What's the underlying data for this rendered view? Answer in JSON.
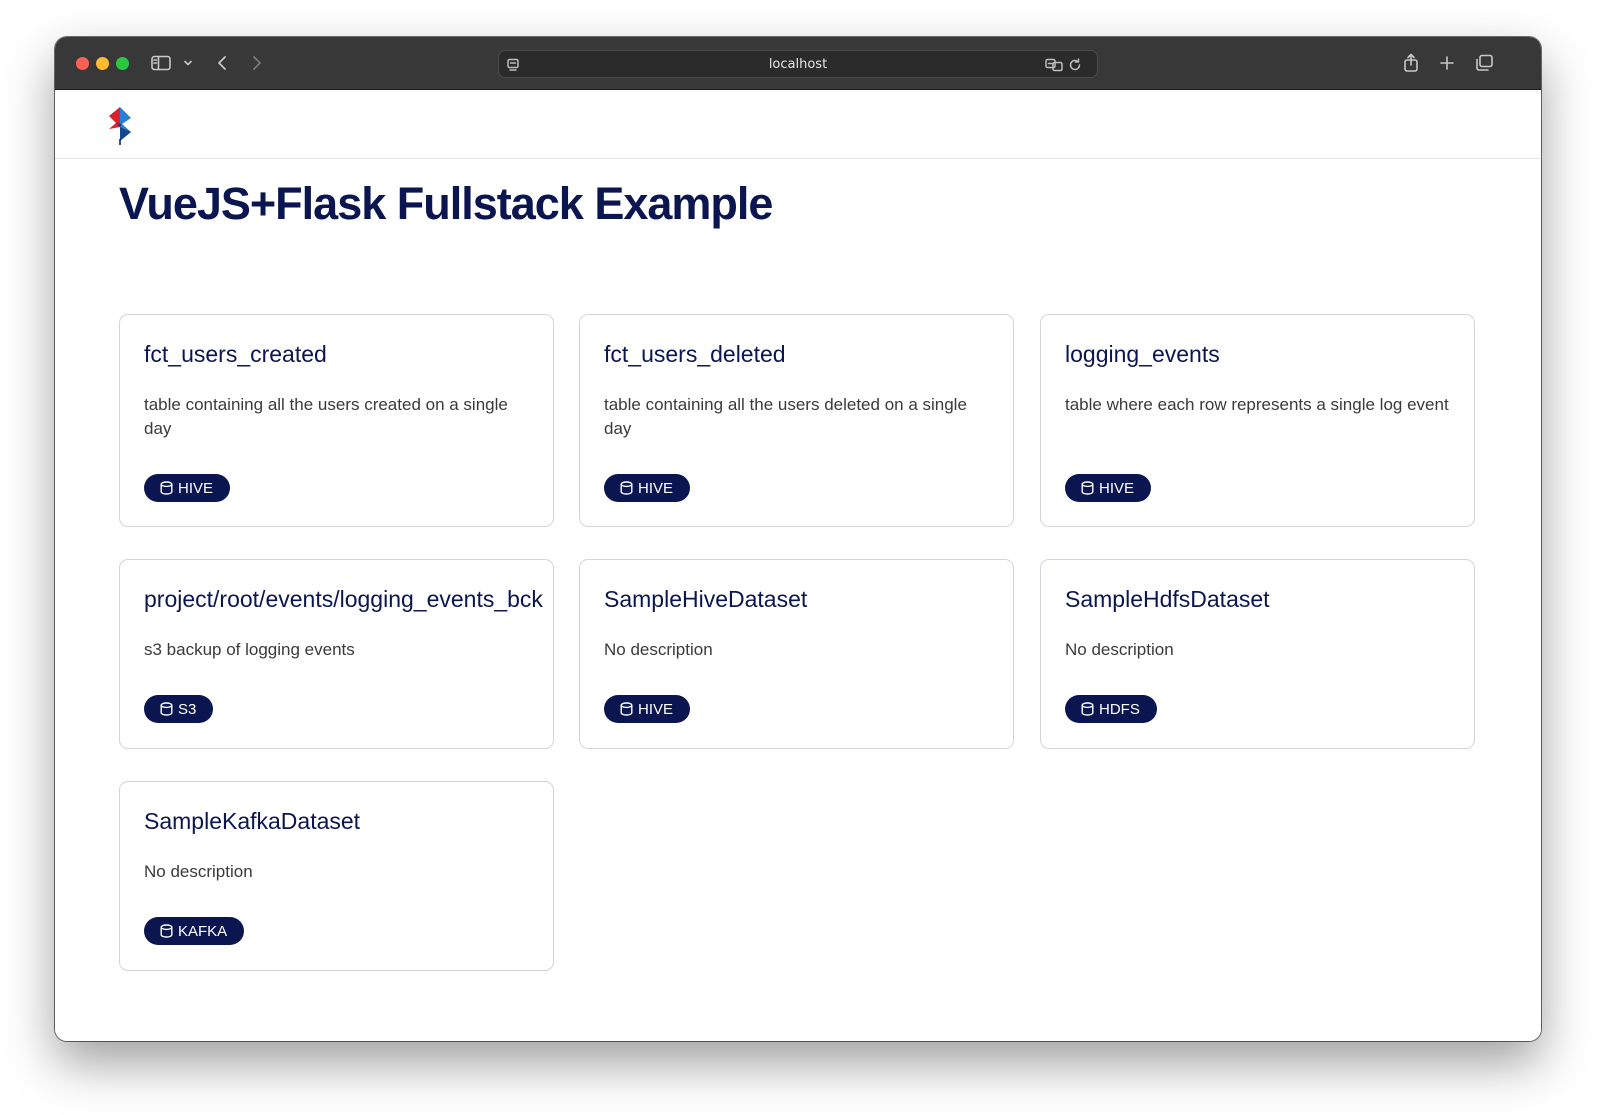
{
  "browser": {
    "url": "localhost"
  },
  "page": {
    "title": "VueJS+Flask Fullstack Example"
  },
  "datasets": [
    {
      "title": "fct_users_created",
      "description": "table containing all the users created on a single day",
      "type": "HIVE"
    },
    {
      "title": "fct_users_deleted",
      "description": "table containing all the users deleted on a single day",
      "type": "HIVE"
    },
    {
      "title": "logging_events",
      "description": "table where each row represents a single log event",
      "type": "HIVE"
    },
    {
      "title": "project/root/events/logging_events_bck",
      "description": "s3 backup of logging events",
      "type": "S3"
    },
    {
      "title": "SampleHiveDataset",
      "description": "No description",
      "type": "HIVE"
    },
    {
      "title": "SampleHdfsDataset",
      "description": "No description",
      "type": "HDFS"
    },
    {
      "title": "SampleKafkaDataset",
      "description": "No description",
      "type": "KAFKA"
    }
  ],
  "colors": {
    "brand_navy": "#0b1650",
    "logo_red": "#d8232a",
    "logo_blue": "#2a7fd4"
  },
  "icons": {
    "badge_icon": "database-icon"
  }
}
